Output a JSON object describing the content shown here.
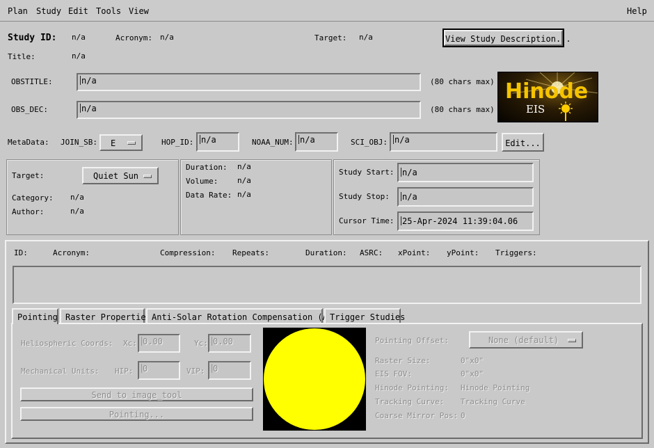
{
  "menu": {
    "plan": "Plan",
    "study": "Study",
    "edit": "Edit",
    "tools": "Tools",
    "view": "View",
    "help": "Help"
  },
  "header": {
    "study_id_label": "Study ID:",
    "study_id_value": "n/a",
    "acronym_label": "Acronym:",
    "acronym_value": "n/a",
    "target_label": "Target:",
    "target_value": "n/a",
    "view_desc_button": "View Study Description...",
    "title_label": "Title:",
    "title_value": "n/a"
  },
  "obs": {
    "obstitle_label": "OBSTITLE:",
    "obstitle_value": "n/a",
    "obstitle_hint": "(80 chars max)",
    "obsdec_label": "OBS_DEC:",
    "obsdec_value": "n/a",
    "obsdec_hint": "(80 chars max)"
  },
  "logo": {
    "text": "Hinode",
    "sub": "EIS"
  },
  "meta": {
    "metadata_label": "MetaData:",
    "join_sb_label": "JOIN_SB:",
    "join_sb_value": "E",
    "hop_id_label": "HOP_ID:",
    "hop_id_value": "n/a",
    "noaa_num_label": "NOAA_NUM:",
    "noaa_num_value": "n/a",
    "sci_obj_label": "SCI_OBJ:",
    "sci_obj_value": "n/a",
    "edit_button": "Edit..."
  },
  "info_left": {
    "target_label": "Target:",
    "target_value": "Quiet Sun",
    "category_label": "Category:",
    "category_value": "n/a",
    "author_label": "Author:",
    "author_value": "n/a"
  },
  "info_mid": {
    "duration_label": "Duration:",
    "duration_value": "n/a",
    "volume_label": "Volume:",
    "volume_value": "n/a",
    "datarate_label": "Data Rate:",
    "datarate_value": "n/a"
  },
  "info_right": {
    "start_label": "Study Start:",
    "start_value": "n/a",
    "stop_label": "Study Stop:",
    "stop_value": "n/a",
    "cursor_label": "Cursor Time:",
    "cursor_value": "25-Apr-2024 11:39:04.06"
  },
  "columns": [
    "ID:",
    "Acronym:",
    "Compression:",
    "Repeats:",
    "Duration:",
    "ASRC:",
    "xPoint:",
    "yPoint:",
    "Triggers:"
  ],
  "tabs": [
    "Pointing",
    "Raster Properties",
    "Anti-Solar Rotation Compensation (ASRC)",
    "Trigger Studies"
  ],
  "pointing": {
    "helio_label": "Heliospheric Coords:",
    "xc_label": "Xc:",
    "xc_value": "0.00",
    "yc_label": "Yc:",
    "yc_value": "0.00",
    "mech_label": "Mechanical Units:",
    "hip_label": "HIP:",
    "hip_value": "0",
    "vip_label": "VIP:",
    "vip_value": "0",
    "send_button": "Send to image_tool",
    "pointing_button": "Pointing...",
    "offset_label": "Pointing Offset:",
    "offset_value": "None (default)",
    "raster_size_label": "Raster Size:",
    "raster_size_value": "0\"x0\"",
    "eis_fov_label": "EIS FOV:",
    "eis_fov_value": "0\"x0\"",
    "hinode_pointing_label": "Hinode Pointing:",
    "hinode_pointing_value": "Hinode Pointing",
    "tracking_label": "Tracking Curve:",
    "tracking_value": "Tracking Curve",
    "coarse_label": "Coarse Mirror Pos:",
    "coarse_value": "0"
  },
  "colors": {
    "background": "#c9c9c9",
    "sun": "#ffff00",
    "sun_bg": "#000000"
  }
}
